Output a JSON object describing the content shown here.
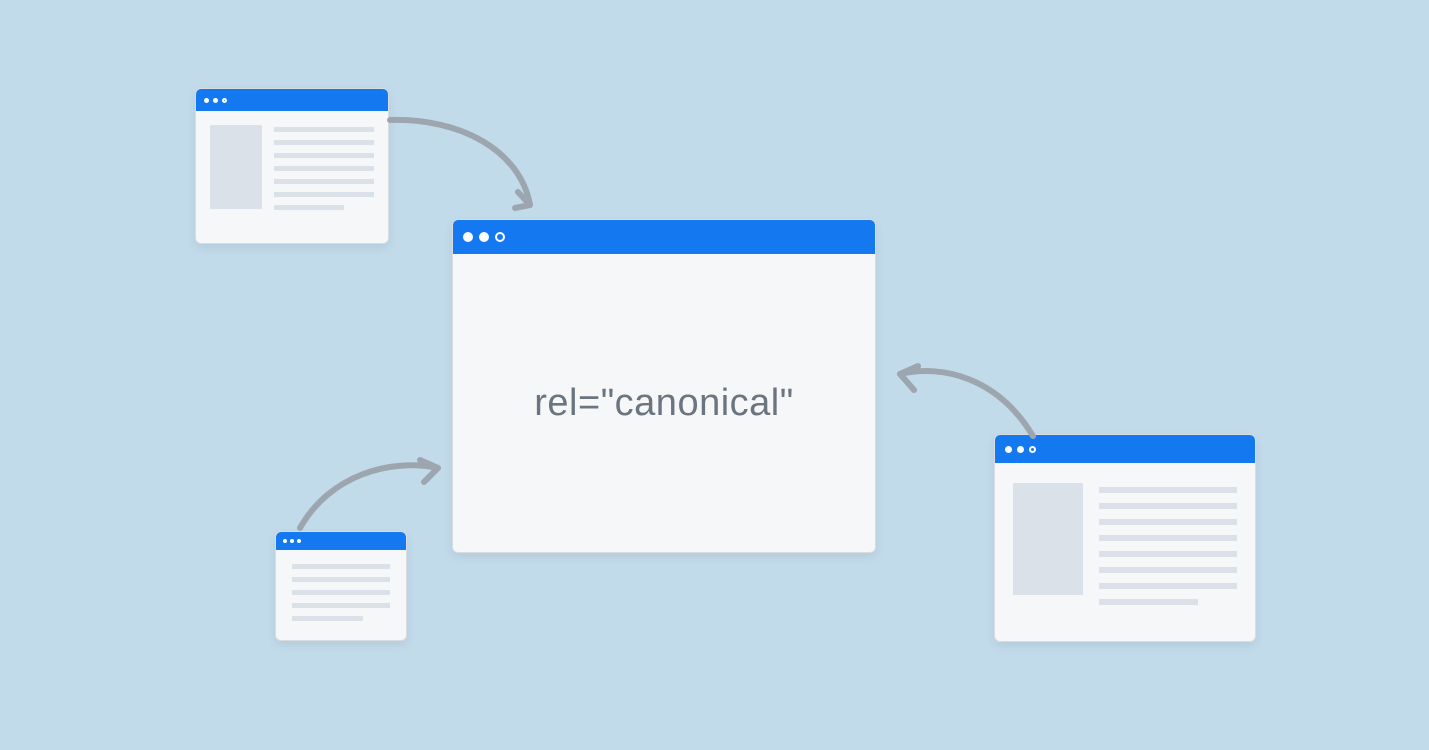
{
  "main": {
    "label": "rel=\"canonical\""
  },
  "colors": {
    "background": "#c2dbeb",
    "titlebar": "#1479f1",
    "windowBg": "#f6f7f8",
    "placeholder": "#dbe1e8",
    "arrow": "#9da6ae",
    "text": "#6b7580"
  }
}
